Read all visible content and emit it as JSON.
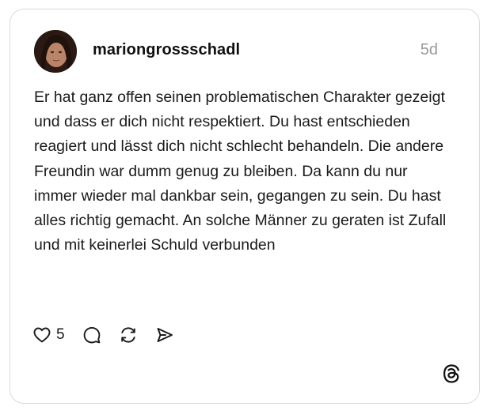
{
  "post": {
    "username": "mariongrossschadl",
    "timestamp": "5d",
    "text": "Er hat ganz offen seinen problematischen Charakter gezeigt und dass er dich nicht respektiert. Du hast entschieden reagiert und lässt dich nicht schlecht behandeln. Die andere Freundin war dumm genug zu bleiben. Da kann du nur immer wieder mal dankbar sein, gegangen zu sein. Du hast alles richtig gemacht. An solche Männer zu geraten ist Zufall und mit keinerlei Schuld verbunden",
    "likes": "5"
  },
  "icons": {
    "like": "heart-icon",
    "reply": "comment-bubble-icon",
    "repost": "repost-icon",
    "share": "send-icon",
    "brand": "threads-logo-icon"
  },
  "colors": {
    "text": "#1a1a1a",
    "muted": "#9a9a9a",
    "border": "#dadada"
  }
}
